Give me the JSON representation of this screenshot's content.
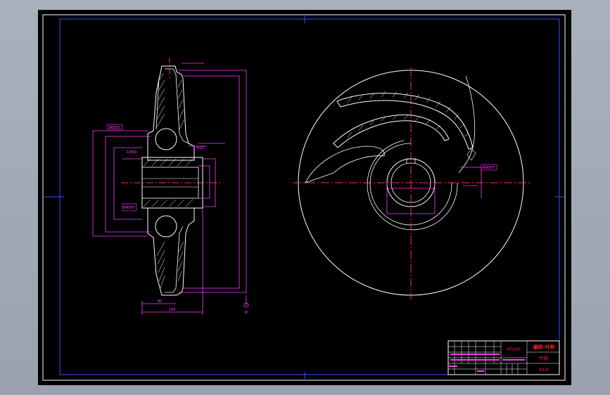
{
  "colors": {
    "background": "#000000",
    "frame": "#0000ff",
    "outline": "#ffffff",
    "dimension": "#ff00ff",
    "centerline": "#ff0000",
    "titleblock_text": "#ff0000"
  },
  "title_block": {
    "part_name": "蜗轮-叶轮",
    "material": "HT200",
    "scale_note": "叶轮",
    "drawing_no": "XX-X"
  },
  "dimensions": {
    "hub_fit": "Φ60H7",
    "hub_bore": "Φ45H7",
    "outer_fit": "Φ90H7",
    "keyway_note": "14JS9",
    "flank_note": "R20",
    "base_length": "160",
    "hub_length": "80",
    "bottom_mark": "Φ"
  }
}
